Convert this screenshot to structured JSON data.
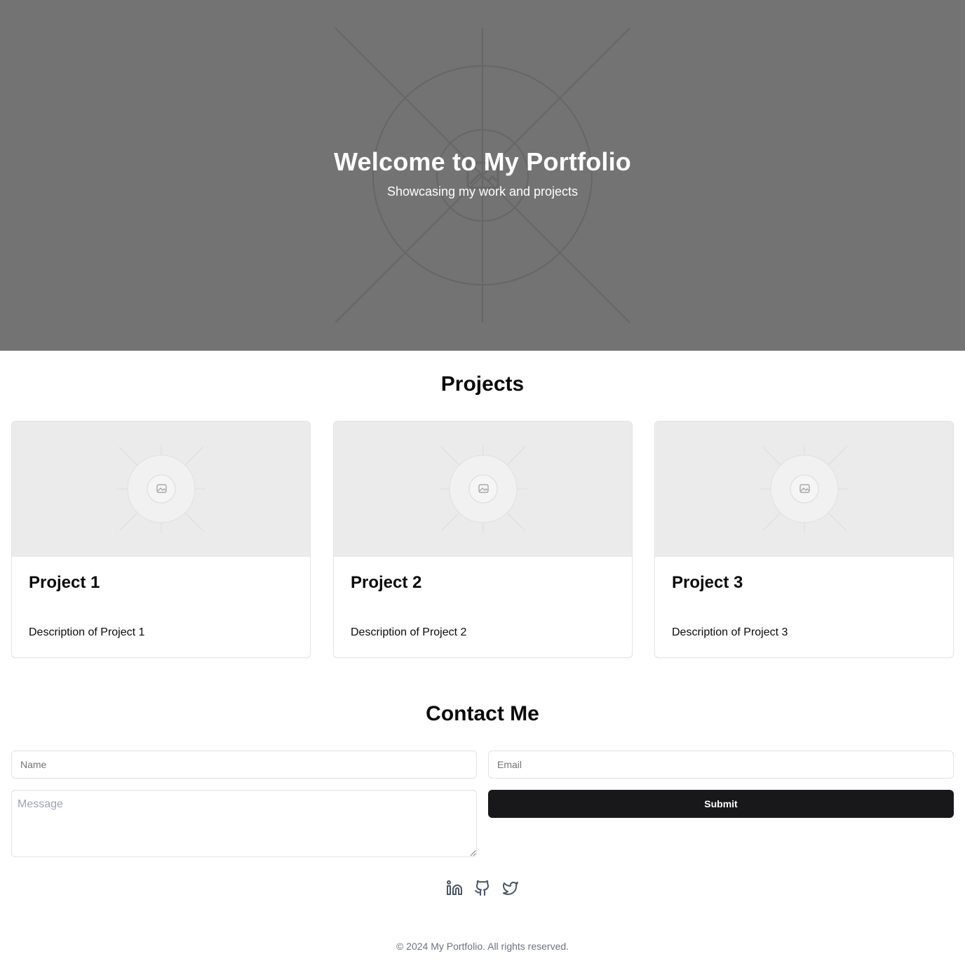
{
  "hero": {
    "title": "Welcome to My Portfolio",
    "subtitle": "Showcasing my work and projects",
    "background_color": "#737373",
    "image_icon": "image-placeholder-icon"
  },
  "projects": {
    "heading": "Projects",
    "items": [
      {
        "title": "Project 1",
        "description": "Description of Project 1",
        "image_icon": "image-placeholder-icon"
      },
      {
        "title": "Project 2",
        "description": "Description of Project 2",
        "image_icon": "image-placeholder-icon"
      },
      {
        "title": "Project 3",
        "description": "Description of Project 3",
        "image_icon": "image-placeholder-icon"
      }
    ]
  },
  "contact": {
    "heading": "Contact Me",
    "name_placeholder": "Name",
    "email_placeholder": "Email",
    "message_placeholder": "Message",
    "submit_label": "Submit",
    "submit_color": "#18181b"
  },
  "social": [
    {
      "icon": "linkedin-icon"
    },
    {
      "icon": "github-icon"
    },
    {
      "icon": "twitter-icon"
    }
  ],
  "footer": {
    "copyright": "© 2024 My Portfolio. All rights reserved."
  }
}
